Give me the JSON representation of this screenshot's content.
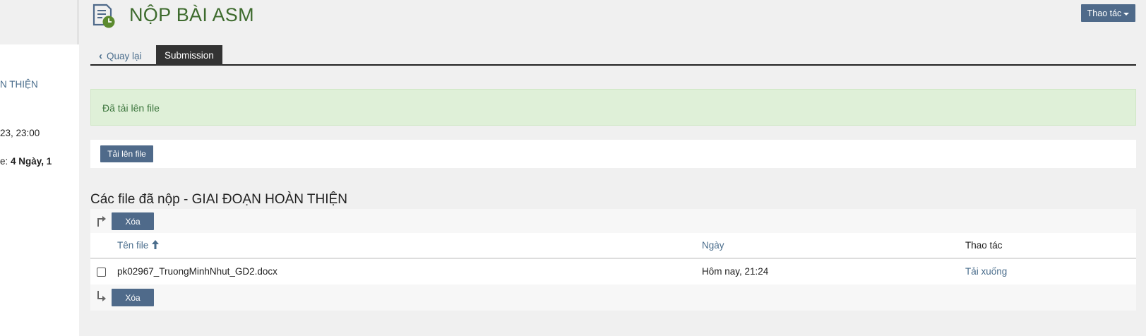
{
  "sidebar": {
    "link_text": "N THIỆN",
    "deadline_text": "23, 23:00",
    "remaining_prefix": "e: ",
    "remaining_value": "4 Ngày, 1"
  },
  "header": {
    "title": "NỘP BÀI ASM",
    "actions_label": "Thao tác"
  },
  "tabs": {
    "back_label": "Quay lại",
    "active_label": "Submission"
  },
  "alert": {
    "message": "Đã tải lên file"
  },
  "upload": {
    "button_label": "Tải lên file"
  },
  "files": {
    "section_title": "Các file đã nộp - GIAI ĐOẠN HOÀN THIỆN",
    "delete_label": "Xóa",
    "columns": {
      "name": "Tên file",
      "date": "Ngày",
      "actions": "Thao tác"
    },
    "rows": [
      {
        "name": "pk02967_TruongMinhNhut_GD2.docx",
        "date": "Hôm nay, 21:24",
        "action": "Tải xuống"
      }
    ]
  },
  "colors": {
    "primary_button": "#4f6a8a",
    "title_green": "#3e6b2e",
    "link_blue": "#4a6d8c",
    "alert_bg": "#dff0d8"
  }
}
